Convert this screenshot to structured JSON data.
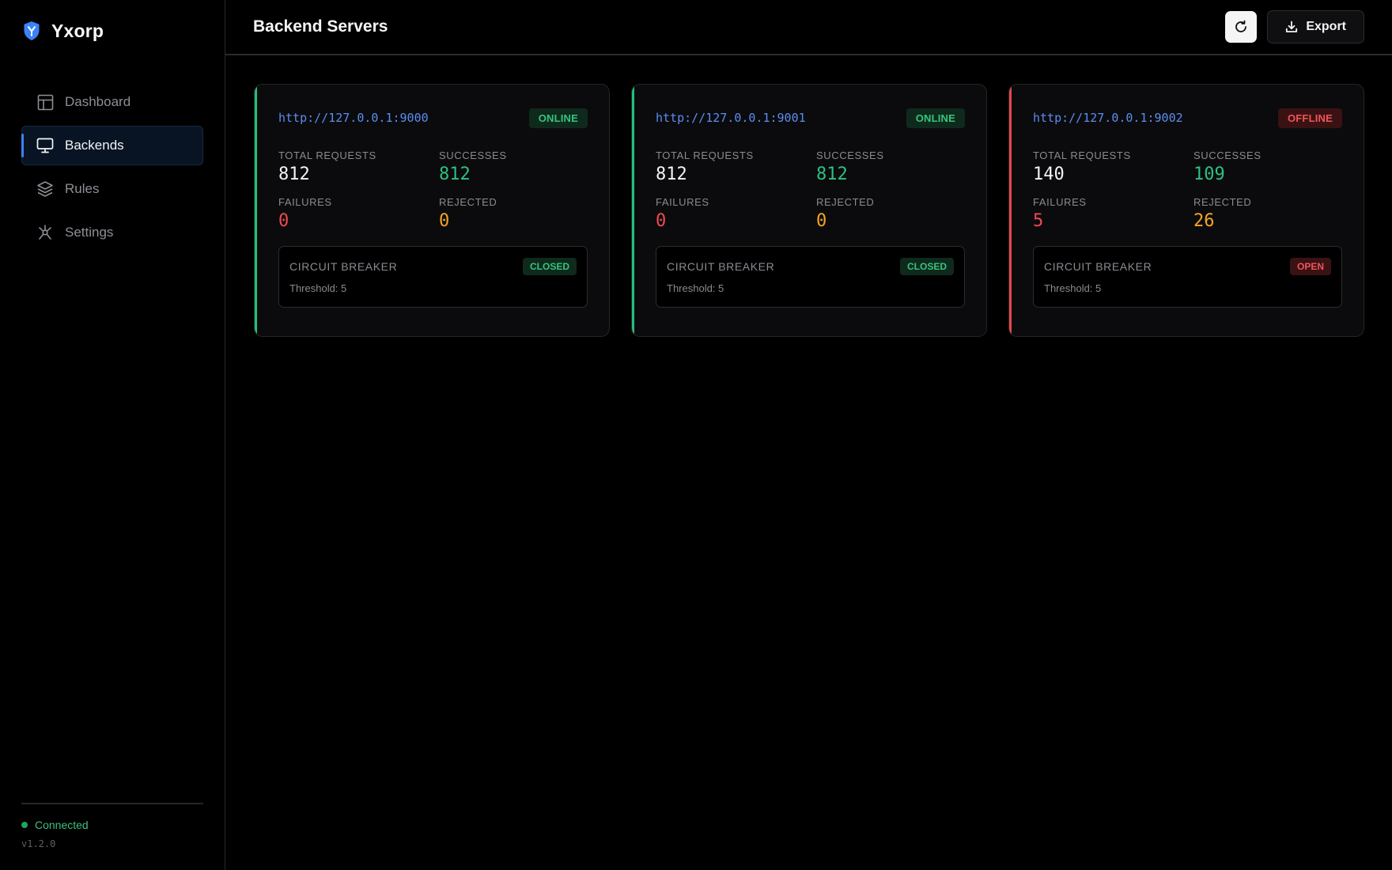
{
  "app": {
    "name": "Yxorp"
  },
  "sidebar": {
    "items": [
      {
        "label": "Dashboard",
        "icon": "layout-icon"
      },
      {
        "label": "Backends",
        "icon": "monitor-icon",
        "active": true
      },
      {
        "label": "Rules",
        "icon": "layers-icon"
      },
      {
        "label": "Settings",
        "icon": "settings-icon"
      }
    ],
    "status": "Connected",
    "version": "v1.2.0"
  },
  "header": {
    "title": "Backend Servers",
    "export_label": "Export"
  },
  "labels": {
    "total_requests": "TOTAL REQUESTS",
    "successes": "SUCCESSES",
    "failures": "FAILURES",
    "rejected": "REJECTED",
    "circuit_breaker": "CIRCUIT BREAKER"
  },
  "backends": [
    {
      "url": "http://127.0.0.1:9000",
      "status": "ONLINE",
      "total_requests": "812",
      "successes": "812",
      "failures": "0",
      "rejected": "0",
      "breaker_state": "CLOSED",
      "threshold": "Threshold: 5"
    },
    {
      "url": "http://127.0.0.1:9001",
      "status": "ONLINE",
      "total_requests": "812",
      "successes": "812",
      "failures": "0",
      "rejected": "0",
      "breaker_state": "CLOSED",
      "threshold": "Threshold: 5"
    },
    {
      "url": "http://127.0.0.1:9002",
      "status": "OFFLINE",
      "total_requests": "140",
      "successes": "109",
      "failures": "5",
      "rejected": "26",
      "breaker_state": "OPEN",
      "threshold": "Threshold: 5"
    }
  ],
  "colors": {
    "accent": "#3b82f6",
    "online": "#22c07a",
    "offline": "#e5484d",
    "warning": "#f5a524"
  }
}
